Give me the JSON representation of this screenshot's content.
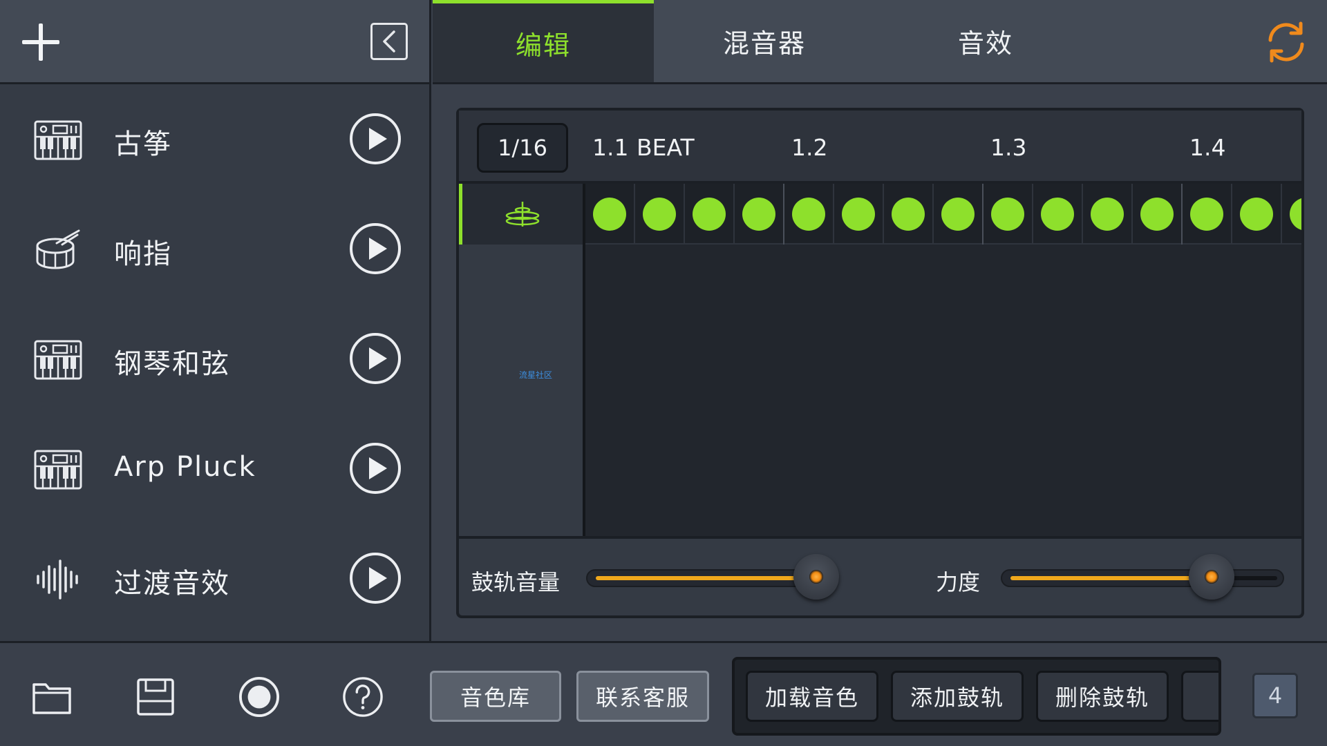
{
  "sidebar": {
    "instruments": [
      {
        "name": "古筝",
        "icon": "keyboard-icon"
      },
      {
        "name": "响指",
        "icon": "drum-icon"
      },
      {
        "name": "钢琴和弦",
        "icon": "keyboard-icon"
      },
      {
        "name": "Arp Pluck",
        "icon": "keyboard-icon"
      },
      {
        "name": "过渡音效",
        "icon": "waveform-icon"
      }
    ]
  },
  "tabs": [
    {
      "label": "编辑",
      "active": true
    },
    {
      "label": "混音器",
      "active": false
    },
    {
      "label": "音效",
      "active": false
    }
  ],
  "sequencer": {
    "grid_resolution": "1/16",
    "beat_labels": [
      "1.1",
      "BEAT",
      "1.2",
      "1.3",
      "1.4"
    ],
    "track_icon": "cymbal-icon",
    "steps_active": [
      true,
      true,
      true,
      true,
      true,
      true,
      true,
      true,
      true,
      true,
      true,
      true,
      true,
      true,
      true
    ],
    "watermark": "流星社区",
    "volume_label": "鼓轨音量",
    "volume_level": 0.94,
    "velocity_label": "力度",
    "velocity_level": 0.76
  },
  "toolbar": {
    "icons": [
      "folder-icon",
      "save-icon",
      "record-icon",
      "help-icon"
    ],
    "sound_library": "音色库",
    "contact_support": "联系客服",
    "load_sound": "加载音色",
    "add_drum_track": "添加鼓轨",
    "delete_drum_track": "删除鼓轨",
    "page_count": "4"
  },
  "colors": {
    "accent_green": "#8ee02c",
    "slider_orange": "#f0a81c",
    "sync_orange": "#f08a1c"
  }
}
